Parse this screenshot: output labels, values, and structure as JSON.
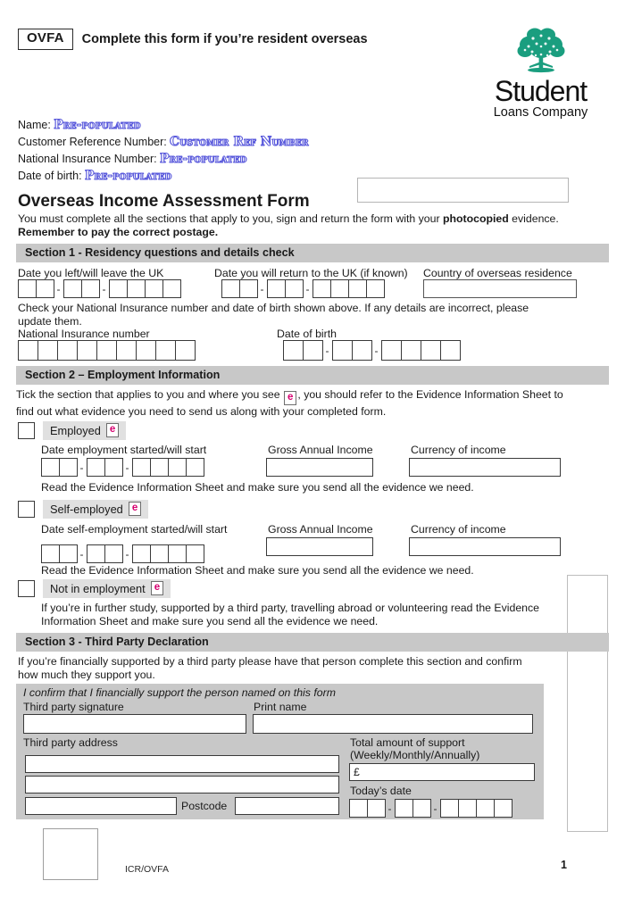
{
  "header": {
    "badge": "OVFA",
    "title": "Complete this form if you’re resident overseas"
  },
  "logo": {
    "icon": "tree-icon",
    "word": "Student",
    "subtitle": "Loans Company",
    "color": "#1a9e7f"
  },
  "identity": {
    "name_label": "Name:",
    "name_value": "Pre-populated",
    "customer_ref_label": "Customer Reference Number:",
    "customer_ref_value": "Customer Ref Number",
    "ni_label": "National Insurance Number:",
    "ni_value": "Pre-populated",
    "dob_label": "Date of birth:",
    "dob_value": "Pre-populated"
  },
  "form": {
    "title": "Overseas Income Assessment Form",
    "intro_part1": "You must complete all the sections that apply to you, sign and return the form with your ",
    "intro_bold1": "photocopied",
    "intro_part2": " evidence. ",
    "intro_bold2": "Remember to pay the correct postage."
  },
  "section1": {
    "heading": "Section 1 - Residency questions and details check",
    "left_uk_label": "Date you left/will leave the UK",
    "return_uk_label": "Date you will return to the UK (if known)",
    "country_label": "Country of  overseas residence",
    "check_text": "Check your National Insurance number and date of birth shown above. If any details are incorrect, please update them.",
    "ni_label": "National Insurance number",
    "dob_label": "Date of birth"
  },
  "section2": {
    "heading": "Section 2 – Employment Information",
    "tick_text_a": "Tick the section that applies to you and where you see ",
    "tick_text_b": ", you should refer to the Evidence Information Sheet to find out what evidence you need to send us along with your completed form.",
    "evidence_icon_letter": "e",
    "evidence_icon_color": "#d6006f",
    "employed": {
      "label": "Employed",
      "date_label": "Date employment started/will start",
      "income_label": "Gross Annual Income",
      "currency_label": "Currency of income",
      "read_text": "Read the Evidence Information Sheet and make sure you send all the evidence we need."
    },
    "self_employed": {
      "label": "Self-employed",
      "date_label": "Date self-employment started/will start",
      "income_label": "Gross Annual Income",
      "currency_label": "Currency of income",
      "read_text": "Read the Evidence Information Sheet and make sure you send all the evidence we need."
    },
    "not_employed": {
      "label": "Not in employment",
      "note": "If you’re in further study, supported by a third party, travelling abroad or volunteering read the Evidence Information Sheet and make sure you send all the evidence we need."
    }
  },
  "section3": {
    "heading": "Section 3 - Third Party Declaration",
    "intro": "If you’re financially supported by a third party please have that person complete this section and confirm how much they support you.",
    "confirm_text": "I confirm that I financially support the person named on this form",
    "signature_label": "Third party signature",
    "print_name_label": "Print name",
    "address_label": "Third party address",
    "postcode_label": "Postcode",
    "support_label_line1": "Total amount of support",
    "support_label_line2": "(Weekly/Monthly/Annually)",
    "currency_symbol": "£",
    "todays_date_label": "Today’s date"
  },
  "footer": {
    "code": "ICR/OVFA",
    "page_number": "1"
  },
  "date_format": {
    "day_cells": 2,
    "month_cells": 2,
    "year_cells": 4,
    "separator": "-"
  },
  "ni_format": {
    "cells": 9
  }
}
